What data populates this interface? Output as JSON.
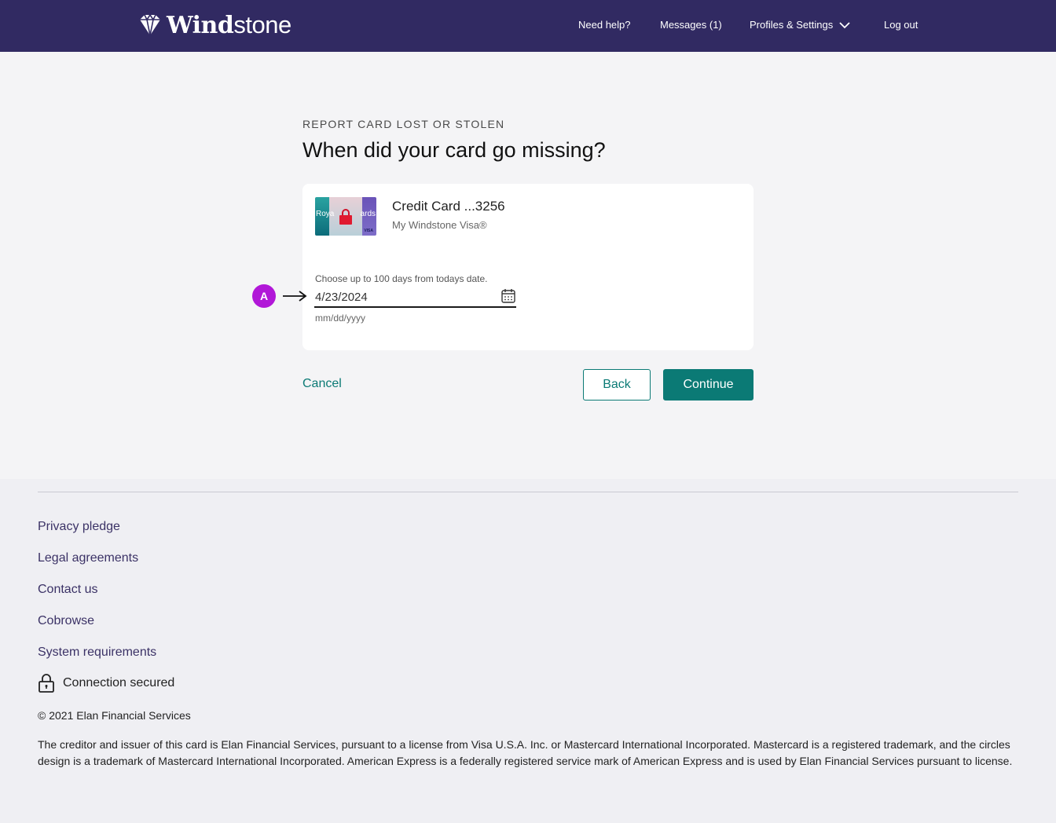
{
  "header": {
    "brand_bold": "Wind",
    "brand_light": "stone",
    "nav": {
      "help": "Need help?",
      "messages": "Messages (1)",
      "profiles": "Profiles & Settings",
      "logout": "Log out"
    }
  },
  "page": {
    "eyebrow": "REPORT CARD LOST OR STOLEN",
    "title": "When did your card go missing?"
  },
  "card": {
    "name": "Credit Card ...3256",
    "product": "My Windstone Visa®",
    "image_text_left": "Roya",
    "image_text_right": "ards",
    "image_network": "VISA"
  },
  "date_field": {
    "hint": "Choose up to 100 days from todays date.",
    "value": "4/23/2024",
    "format": "mm/dd/yyyy"
  },
  "annotation": {
    "badge": "A"
  },
  "actions": {
    "cancel": "Cancel",
    "back": "Back",
    "continue": "Continue"
  },
  "footer": {
    "links": [
      "Privacy pledge",
      "Legal agreements",
      "Contact us",
      "Cobrowse",
      "System requirements"
    ],
    "secure": "Connection secured",
    "copyright": "© 2021 Elan Financial Services",
    "legal": "The creditor and issuer of this card is Elan Financial Services, pursuant to a license from Visa U.S.A. Inc. or Mastercard International Incorporated. Mastercard is a registered trademark, and the circles design is a trademark of Mastercard International Incorporated. American Express is a federally registered service mark of American Express and is used by Elan Financial Services pursuant to license."
  },
  "colors": {
    "header_bg": "#312a62",
    "accent_teal": "#0b7a75",
    "annotation_purple": "#b117d8",
    "footer_link": "#3b3266"
  }
}
